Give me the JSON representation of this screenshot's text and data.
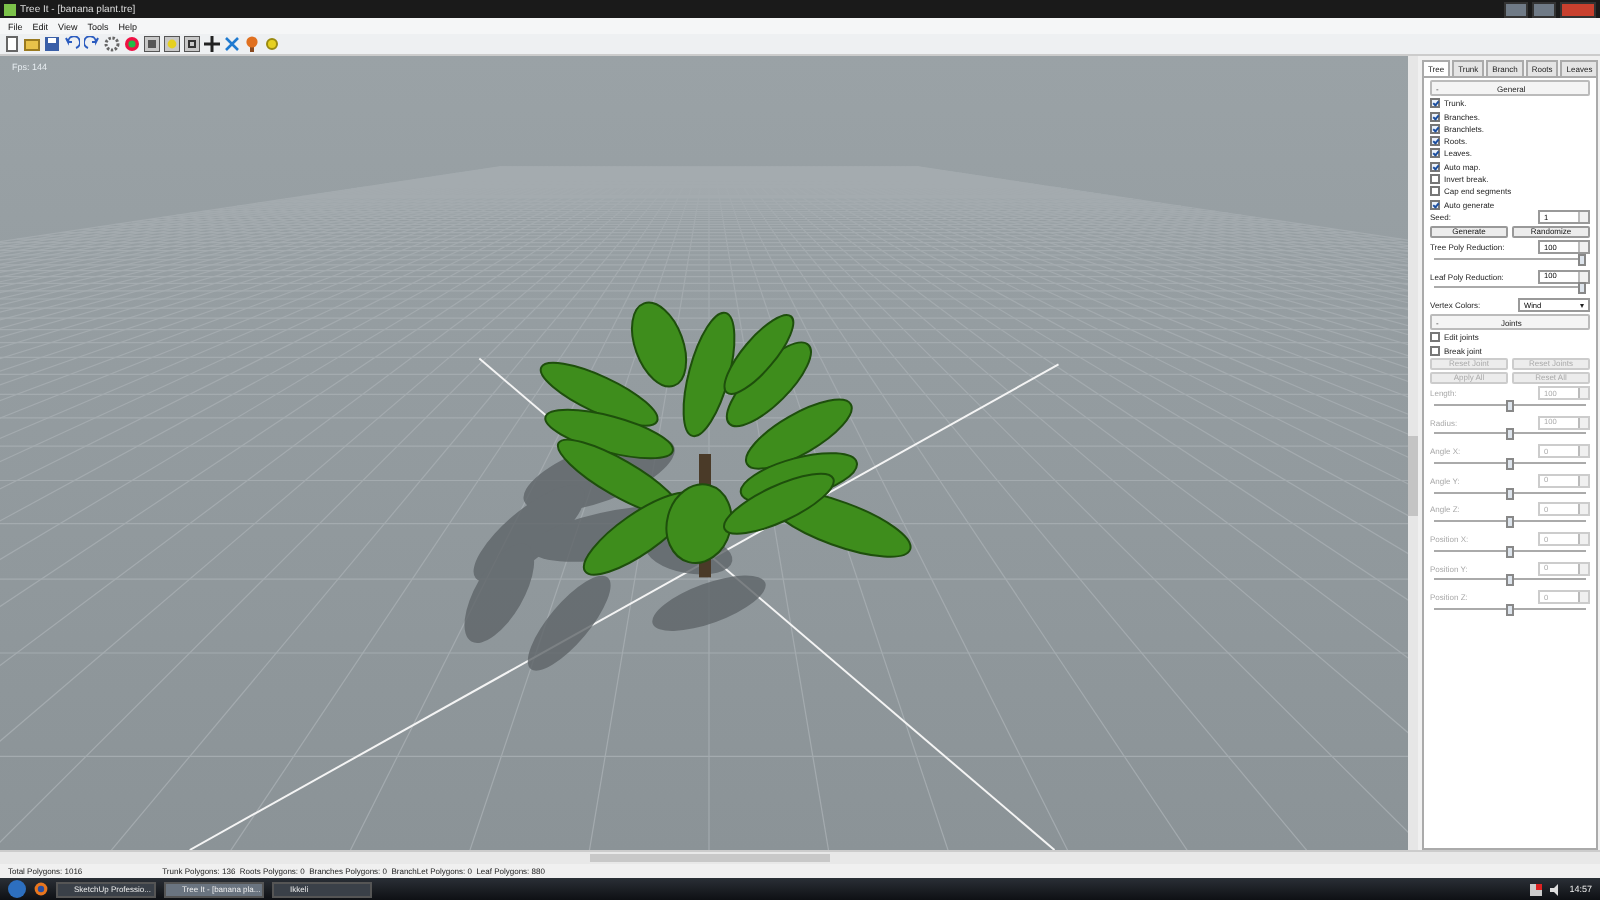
{
  "window": {
    "title": "Tree It - [banana plant.tre]"
  },
  "menu": [
    "File",
    "Edit",
    "View",
    "Tools",
    "Help"
  ],
  "viewport": {
    "fps": "Fps: 144"
  },
  "panel": {
    "tabs": [
      {
        "label": "Tree",
        "selected": true
      },
      {
        "label": "Trunk",
        "selected": false
      },
      {
        "label": "Branch",
        "selected": false
      },
      {
        "label": "Roots",
        "selected": false
      },
      {
        "label": "Leaves",
        "selected": false
      }
    ],
    "items": [
      {
        "kind": "header",
        "sign": "-",
        "label": "General"
      },
      {
        "kind": "check",
        "label": "Trunk.",
        "checked": true
      },
      {
        "kind": "check",
        "label": "Branches.",
        "checked": true
      },
      {
        "kind": "check",
        "label": "Branchlets.",
        "checked": true
      },
      {
        "kind": "check",
        "label": "Roots.",
        "checked": true
      },
      {
        "kind": "check",
        "label": "Leaves.",
        "checked": true
      },
      {
        "kind": "check",
        "label": "Auto map.",
        "checked": true
      },
      {
        "kind": "check",
        "label": "Invert break.",
        "checked": false
      },
      {
        "kind": "check",
        "label": "Cap end segments",
        "checked": false
      },
      {
        "kind": "check",
        "label": "Auto generate",
        "checked": true
      },
      {
        "kind": "spin",
        "label": "Seed:",
        "value": "1",
        "disabled": false
      },
      {
        "kind": "buttons",
        "labels": [
          "Generate",
          "Randomize"
        ],
        "disabled": false
      },
      {
        "kind": "slider",
        "label": "Tree Poly Reduction:",
        "value": "100",
        "level": 1,
        "disabled": false
      },
      {
        "kind": "slider",
        "label": "Leaf Poly Reduction:",
        "value": "100",
        "level": 1,
        "disabled": false
      },
      {
        "kind": "select",
        "label": "Vertex Colors:",
        "value": "Wind"
      },
      {
        "kind": "header",
        "sign": "-",
        "label": "Joints"
      },
      {
        "kind": "check",
        "label": "Edit joints",
        "checked": false
      },
      {
        "kind": "check",
        "label": "Break joint",
        "checked": false
      },
      {
        "kind": "buttons",
        "labels": [
          "Reset Joint",
          "Reset Joints"
        ],
        "disabled": true
      },
      {
        "kind": "buttons",
        "labels": [
          "Apply All",
          "Reset All"
        ],
        "disabled": true
      },
      {
        "kind": "slider",
        "label": "Length:",
        "value": "100",
        "level": 0.5,
        "disabled": true
      },
      {
        "kind": "slider",
        "label": "Radius:",
        "value": "100",
        "level": 0.5,
        "disabled": true
      },
      {
        "kind": "slider",
        "label": "Angle X:",
        "value": "0",
        "level": 0.5,
        "disabled": true
      },
      {
        "kind": "slider",
        "label": "Angle Y:",
        "value": "0",
        "level": 0.5,
        "disabled": true
      },
      {
        "kind": "slider",
        "label": "Angle Z:",
        "value": "0",
        "level": 0.5,
        "disabled": true
      },
      {
        "kind": "slider",
        "label": "Position X:",
        "value": "0",
        "level": 0.5,
        "disabled": true
      },
      {
        "kind": "slider",
        "label": "Position Y:",
        "value": "0",
        "level": 0.5,
        "disabled": true
      },
      {
        "kind": "slider",
        "label": "Position Z:",
        "value": "0",
        "level": 0.5,
        "disabled": true
      }
    ]
  },
  "status_bar": {
    "total": "Total Polygons: 1016",
    "detail": "Trunk Polygons: 136  Roots Polygons: 0  Branches Polygons: 0  BranchLet Polygons: 0  Leaf Polygons: 880"
  },
  "taskbar": {
    "tasks": [
      {
        "label": "SketchUp Professio...",
        "selected": false
      },
      {
        "label": "Tree It - [banana pla...",
        "selected": true
      },
      {
        "label": "Ikkeli",
        "selected": false
      }
    ],
    "clock": "14:57"
  }
}
